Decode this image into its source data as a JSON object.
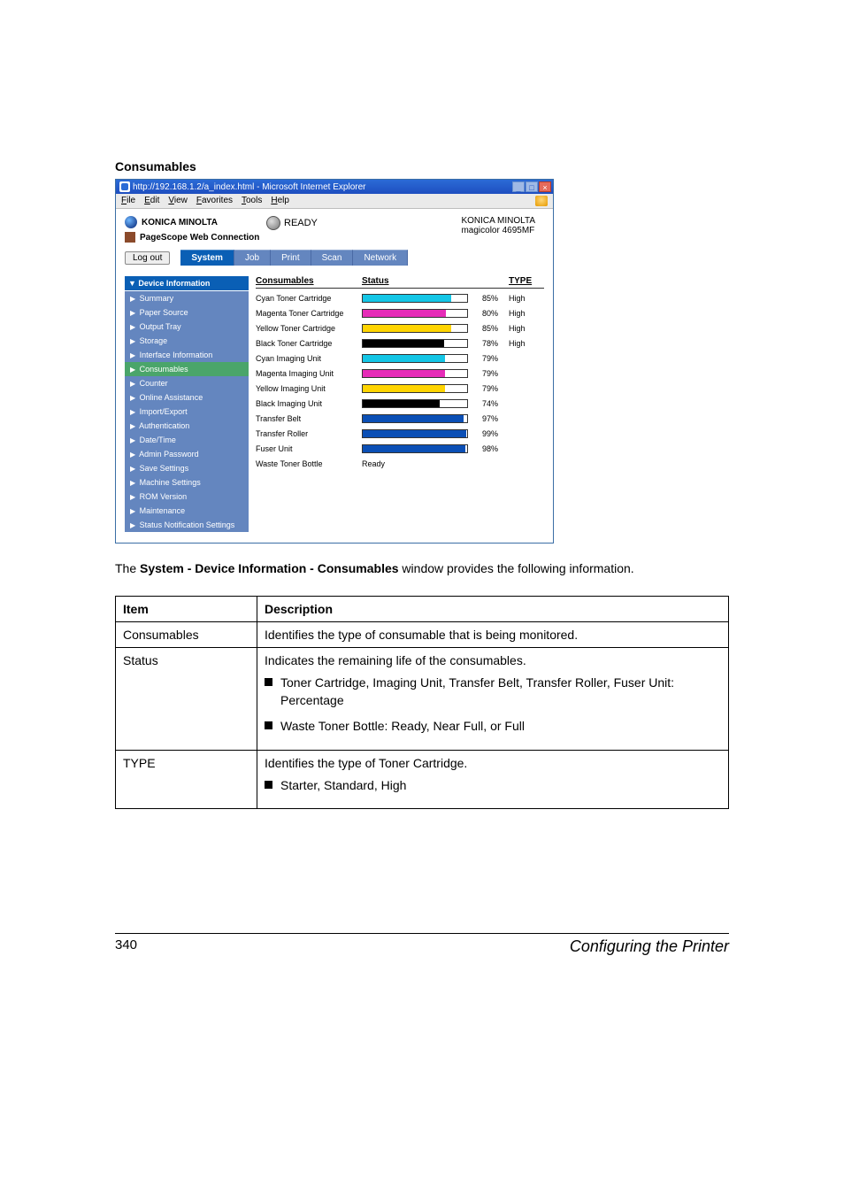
{
  "section_title": "Consumables",
  "ie": {
    "title": "http://192.168.1.2/a_index.html - Microsoft Internet Explorer",
    "menu": [
      "File",
      "Edit",
      "View",
      "Favorites",
      "Tools",
      "Help"
    ],
    "btn_min": "_",
    "btn_max": "□",
    "btn_close": "×"
  },
  "header": {
    "brand": "KONICA MINOLTA",
    "subbrand": "PageScope Web Connection",
    "ready": "READY",
    "line1": "KONICA MINOLTA",
    "line2": "magicolor 4695MF"
  },
  "logout": "Log out",
  "tabs": [
    "System",
    "Job",
    "Print",
    "Scan",
    "Network"
  ],
  "sidebar_title": "▼ Device Information",
  "sidebar": [
    {
      "label": "Summary",
      "current": false
    },
    {
      "label": "Paper Source",
      "current": false
    },
    {
      "label": "Output Tray",
      "current": false
    },
    {
      "label": "Storage",
      "current": false
    },
    {
      "label": "Interface Information",
      "current": false
    },
    {
      "label": "Consumables",
      "current": true
    },
    {
      "label": "Counter",
      "current": false
    },
    {
      "label": "Online Assistance",
      "current": false
    },
    {
      "label": "Import/Export",
      "current": false
    },
    {
      "label": "Authentication",
      "current": false
    },
    {
      "label": "Date/Time",
      "current": false
    },
    {
      "label": "Admin Password",
      "current": false
    },
    {
      "label": "Save Settings",
      "current": false
    },
    {
      "label": "Machine Settings",
      "current": false
    },
    {
      "label": "ROM Version",
      "current": false
    },
    {
      "label": "Maintenance",
      "current": false
    },
    {
      "label": "Status Notification Settings",
      "current": false
    }
  ],
  "columns": {
    "name": "Consumables",
    "status": "Status",
    "type": "TYPE"
  },
  "rows": [
    {
      "name": "Cyan Toner Cartridge",
      "color": "#14c6e6",
      "pct": 85,
      "type": "High"
    },
    {
      "name": "Magenta Toner Cartridge",
      "color": "#e62cb8",
      "pct": 80,
      "type": "High"
    },
    {
      "name": "Yellow Toner Cartridge",
      "color": "#ffd400",
      "pct": 85,
      "type": "High"
    },
    {
      "name": "Black Toner Cartridge",
      "color": "#000000",
      "pct": 78,
      "type": "High"
    },
    {
      "name": "Cyan Imaging Unit",
      "color": "#14c6e6",
      "pct": 79,
      "type": ""
    },
    {
      "name": "Magenta Imaging Unit",
      "color": "#e62cb8",
      "pct": 79,
      "type": ""
    },
    {
      "name": "Yellow Imaging Unit",
      "color": "#ffd400",
      "pct": 79,
      "type": ""
    },
    {
      "name": "Black Imaging Unit",
      "color": "#000000",
      "pct": 74,
      "type": ""
    },
    {
      "name": "Transfer Belt",
      "color": "#0b4fb5",
      "pct": 97,
      "type": ""
    },
    {
      "name": "Transfer Roller",
      "color": "#0b4fb5",
      "pct": 99,
      "type": ""
    },
    {
      "name": "Fuser Unit",
      "color": "#0b4fb5",
      "pct": 98,
      "type": ""
    },
    {
      "name": "Waste Toner Bottle",
      "text": "Ready"
    }
  ],
  "caption_pre": "The ",
  "caption_bold": "System - Device Information - Consumables",
  "caption_post": " window provides the following information.",
  "table": {
    "hdr_item": "Item",
    "hdr_desc": "Description",
    "r1_item": "Consumables",
    "r1_desc": "Identifies the type of consumable that is being monitored.",
    "r2_item": "Status",
    "r2_desc": "Indicates the remaining life of the consumables.",
    "r2_b1": "Toner Cartridge, Imaging Unit, Transfer Belt, Transfer Roller, Fuser Unit: Percentage",
    "r2_b2": "Waste Toner Bottle: Ready, Near Full, or Full",
    "r3_item": "TYPE",
    "r3_desc": "Identifies the type of Toner Cartridge.",
    "r3_b1": "Starter, Standard, High"
  },
  "footer": {
    "page": "340",
    "right": "Configuring the Printer"
  }
}
